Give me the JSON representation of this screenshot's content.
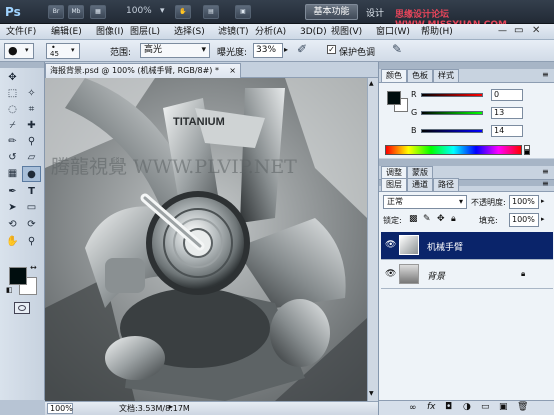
{
  "app": {
    "logo": "Ps",
    "zoom": "100%",
    "workspace_button": "基本功能",
    "design_label": "设计",
    "watermark": "思缘设计论坛 WWW.MISSYUAN.COM"
  },
  "menu": [
    "文件(F)",
    "编辑(E)",
    "图像(I)",
    "图层(L)",
    "选择(S)",
    "滤镜(T)",
    "分析(A)",
    "3D(D)",
    "视图(V)",
    "窗口(W)",
    "帮助(H)"
  ],
  "options": {
    "brush_size": "45",
    "range_label": "范围:",
    "range_value": "高光",
    "exposure_label": "曝光度:",
    "exposure_value": "33%",
    "protect_label": "保护色调",
    "protect_checked": true
  },
  "document": {
    "tab_title": "海报背景.psd @ 100% (机械手臂, RGB/8#) *",
    "close": "×",
    "zoom": "100%",
    "doc_info": "文档:3.53M/8.17M",
    "image_text": "TITANIUM",
    "overlay_watermark": "腾龍視覺 WWW.PLVIP.NET"
  },
  "color_panel": {
    "tabs": [
      "颜色",
      "色板",
      "样式"
    ],
    "channels": [
      {
        "label": "R",
        "value": "0"
      },
      {
        "label": "G",
        "value": "13"
      },
      {
        "label": "B",
        "value": "14"
      }
    ],
    "fg_color": "#000d0e"
  },
  "adjust_tabs": [
    "调整",
    "蒙版"
  ],
  "layers_panel": {
    "tabs": [
      "图层",
      "通道",
      "路径"
    ],
    "blend_mode": "正常",
    "opacity_label": "不透明度:",
    "opacity_value": "100%",
    "lock_label": "锁定:",
    "fill_label": "填充:",
    "fill_value": "100%",
    "layers": [
      {
        "name": "机械手臂",
        "selected": true
      },
      {
        "name": "背景",
        "selected": false,
        "locked": true
      }
    ]
  },
  "accent": "#0a246a"
}
